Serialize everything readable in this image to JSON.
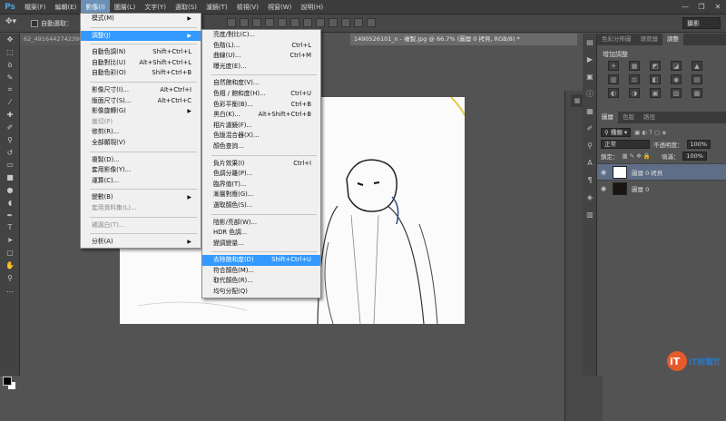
{
  "menubar": {
    "logo": "Ps",
    "items": [
      "檔案(F)",
      "編輯(E)",
      "影像(I)",
      "圖層(L)",
      "文字(Y)",
      "選取(S)",
      "濾鏡(T)",
      "檢視(V)",
      "視窗(W)",
      "說明(H)"
    ],
    "window_controls": [
      "—",
      "❐",
      "✕"
    ]
  },
  "options_bar": {
    "auto_select_label": "自動選取：",
    "workspace": "攝影"
  },
  "doc_tabs": {
    "left": "62_4916442742398",
    "right": "1490526101_n - 複製.jpg @ 66.7% (圖層 0 拷貝, RGB/8) *"
  },
  "image_menu": {
    "items": [
      {
        "label": "模式(M)",
        "shortcut": "",
        "arrow": true,
        "disabled": false
      },
      {
        "sep": true
      },
      {
        "label": "調整(J)",
        "shortcut": "",
        "arrow": true,
        "disabled": false,
        "highlight": true
      },
      {
        "sep": true
      },
      {
        "label": "自動色調(N)",
        "shortcut": "Shift+Ctrl+L",
        "disabled": false
      },
      {
        "label": "自動對比(U)",
        "shortcut": "Alt+Shift+Ctrl+L",
        "disabled": false
      },
      {
        "label": "自動色彩(O)",
        "shortcut": "Shift+Ctrl+B",
        "disabled": false
      },
      {
        "sep": true
      },
      {
        "label": "影像尺寸(I)...",
        "shortcut": "Alt+Ctrl+I",
        "disabled": false
      },
      {
        "label": "版面尺寸(S)...",
        "shortcut": "Alt+Ctrl+C",
        "disabled": false
      },
      {
        "label": "影像旋轉(G)",
        "shortcut": "",
        "arrow": true,
        "disabled": false
      },
      {
        "label": "裁切(P)",
        "shortcut": "",
        "disabled": true
      },
      {
        "label": "修剪(R)...",
        "shortcut": "",
        "disabled": false
      },
      {
        "label": "全部顯現(V)",
        "shortcut": "",
        "disabled": false
      },
      {
        "sep": true
      },
      {
        "label": "複製(D)...",
        "shortcut": "",
        "disabled": false
      },
      {
        "label": "套用影像(Y)...",
        "shortcut": "",
        "disabled": false
      },
      {
        "label": "運算(C)...",
        "shortcut": "",
        "disabled": false
      },
      {
        "sep": true
      },
      {
        "label": "變數(B)",
        "shortcut": "",
        "arrow": true,
        "disabled": false
      },
      {
        "label": "套用資料集(L)...",
        "shortcut": "",
        "disabled": true
      },
      {
        "sep": true
      },
      {
        "label": "補漏白(T)...",
        "shortcut": "",
        "disabled": true
      },
      {
        "sep": true
      },
      {
        "label": "分析(A)",
        "shortcut": "",
        "arrow": true,
        "disabled": false
      }
    ]
  },
  "adjust_menu": {
    "items": [
      {
        "label": "亮度/對比(C)...",
        "shortcut": ""
      },
      {
        "label": "色階(L)...",
        "shortcut": "Ctrl+L"
      },
      {
        "label": "曲線(U)...",
        "shortcut": "Ctrl+M"
      },
      {
        "label": "曝光度(E)...",
        "shortcut": ""
      },
      {
        "sep": true
      },
      {
        "label": "自然飽和度(V)...",
        "shortcut": ""
      },
      {
        "label": "色相 / 飽和度(H)...",
        "shortcut": "Ctrl+U"
      },
      {
        "label": "色彩平衡(B)...",
        "shortcut": "Ctrl+B"
      },
      {
        "label": "黑白(K)...",
        "shortcut": "Alt+Shift+Ctrl+B"
      },
      {
        "label": "相片濾鏡(F)...",
        "shortcut": ""
      },
      {
        "label": "色版混合器(X)...",
        "shortcut": ""
      },
      {
        "label": "顏色查詢...",
        "shortcut": ""
      },
      {
        "sep": true
      },
      {
        "label": "負片效果(I)",
        "shortcut": "Ctrl+I"
      },
      {
        "label": "色調分離(P)...",
        "shortcut": ""
      },
      {
        "label": "臨界值(T)...",
        "shortcut": ""
      },
      {
        "label": "漸層對應(G)...",
        "shortcut": ""
      },
      {
        "label": "選取顏色(S)...",
        "shortcut": ""
      },
      {
        "sep": true
      },
      {
        "label": "陰影/亮部(W)...",
        "shortcut": ""
      },
      {
        "label": "HDR 色調...",
        "shortcut": ""
      },
      {
        "label": "變調變量...",
        "shortcut": ""
      },
      {
        "sep": true
      },
      {
        "label": "去除飽和度(D)",
        "shortcut": "Shift+Ctrl+U",
        "highlight": true
      },
      {
        "label": "符合顏色(M)...",
        "shortcut": ""
      },
      {
        "label": "取代顏色(R)...",
        "shortcut": ""
      },
      {
        "label": "均勻分配(Q)",
        "shortcut": ""
      }
    ]
  },
  "panels": {
    "top_tabs": [
      "色彩分佈圖",
      "導覽器",
      "調整"
    ],
    "adjust_title": "增加調整",
    "adjust_row1": [
      "☀",
      "▦",
      "◩",
      "◪",
      "▲"
    ],
    "adjust_row2": [
      "▥",
      "⚖",
      "◧",
      "◉",
      "▤"
    ],
    "adjust_row3": [
      "◐",
      "◑",
      "▣",
      "▨",
      "▦"
    ],
    "layer_tabs": [
      "圖層",
      "色版",
      "路徑"
    ],
    "kind_label": "種類",
    "blend_mode": "正常",
    "opacity_label": "不透明度：",
    "opacity_value": "100%",
    "lock_label": "鎖定：",
    "fill_label": "填滿：",
    "fill_value": "100%",
    "layers": [
      {
        "name": "圖層 0 拷貝",
        "selected": true
      },
      {
        "name": "圖層 0",
        "selected": false
      }
    ]
  },
  "watermark": {
    "text": "iT邦幫忙"
  }
}
